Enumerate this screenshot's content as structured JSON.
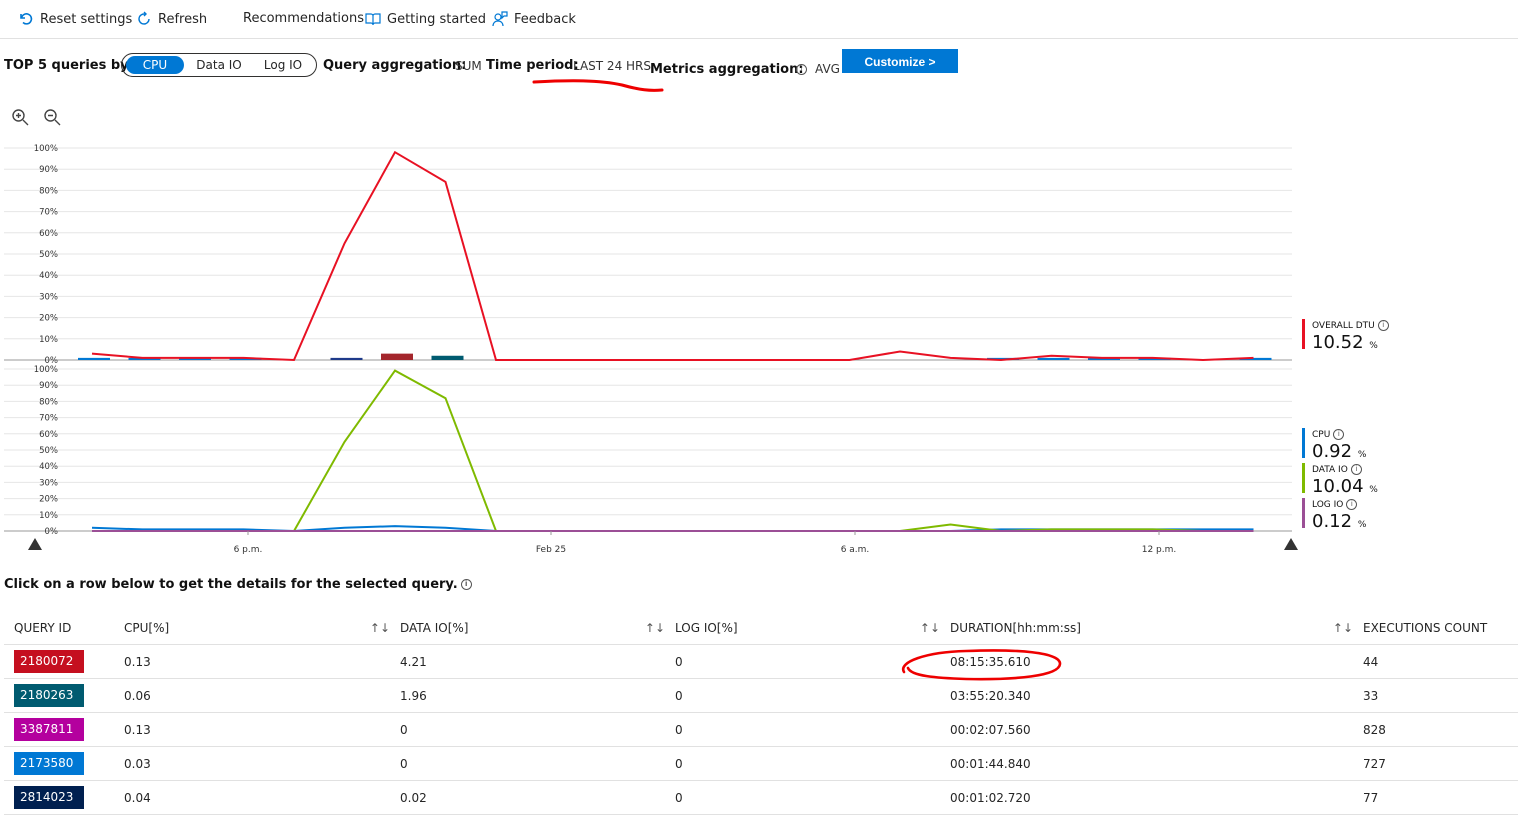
{
  "toolbar": {
    "reset": "Reset settings",
    "refresh": "Refresh",
    "recommendations": "Recommendations",
    "getting_started": "Getting started",
    "feedback": "Feedback"
  },
  "filters": {
    "top_label": "TOP 5 queries by:",
    "options": [
      "CPU",
      "Data IO",
      "Log IO"
    ],
    "selected": "CPU",
    "query_agg_label": "Query aggregation:",
    "query_agg_value": "SUM",
    "time_period_label": "Time period:",
    "time_period_value": "LAST 24 HRS",
    "metrics_agg_label": "Metrics aggregation:",
    "metrics_agg_value": "AVG",
    "customize": "Customize >"
  },
  "chart_data": [
    {
      "type": "line",
      "ylim": [
        0,
        100
      ],
      "yticks": [
        "100%",
        "90%",
        "80%",
        "70%",
        "60%",
        "50%",
        "40%",
        "30%",
        "20%",
        "10%",
        "0%"
      ],
      "series": [
        {
          "name": "OVERALL DTU",
          "color": "#e81123",
          "values": [
            3,
            1,
            1,
            1,
            0,
            55,
            98,
            84,
            0,
            0,
            0,
            0,
            0,
            0,
            0,
            0,
            4,
            1,
            0,
            2,
            1,
            1,
            0,
            1
          ]
        }
      ],
      "bars": {
        "colors": [
          "#0078d4",
          "#0078d4",
          "#0078d4",
          "#0078d4",
          "#0078d4",
          "#1e3a8a",
          "#a4262c",
          "#005b70",
          "#0078d4",
          "#0078d4",
          "#0078d4",
          "#0078d4",
          "#0078d4",
          "#0078d4",
          "#0078d4",
          "#0078d4",
          "#0078d4",
          "#0078d4",
          "#0078d4",
          "#0078d4",
          "#0078d4",
          "#0078d4",
          "#0078d4",
          "#0078d4"
        ],
        "values": [
          1,
          1,
          1,
          1,
          0,
          1,
          3,
          2,
          0,
          0,
          0,
          0,
          0,
          0,
          0,
          0,
          0,
          0,
          1,
          1,
          1,
          1,
          0,
          1
        ]
      },
      "legend": [
        {
          "label": "OVERALL DTU",
          "value": "10.52",
          "unit": "%",
          "color": "#e81123"
        }
      ]
    },
    {
      "type": "line",
      "ylim": [
        0,
        100
      ],
      "yticks": [
        "100%",
        "90%",
        "80%",
        "70%",
        "60%",
        "50%",
        "40%",
        "30%",
        "20%",
        "10%",
        "0%"
      ],
      "xticks": [
        "6 p.m.",
        "Feb 25",
        "6 a.m.",
        "12 p.m."
      ],
      "series": [
        {
          "name": "CPU",
          "color": "#0078d4",
          "values": [
            2,
            1,
            1,
            1,
            0,
            2,
            3,
            2,
            0,
            0,
            0,
            0,
            0,
            0,
            0,
            0,
            0,
            0,
            1,
            1,
            1,
            1,
            1,
            1
          ]
        },
        {
          "name": "DATA IO",
          "color": "#7fba00",
          "values": [
            0,
            0,
            0,
            0,
            0,
            55,
            99,
            82,
            0,
            0,
            0,
            0,
            0,
            0,
            0,
            0,
            0,
            4,
            0,
            1,
            1,
            1,
            0,
            0
          ]
        },
        {
          "name": "LOG IO",
          "color": "#9b4f96",
          "values": [
            0,
            0,
            0,
            0,
            0,
            0,
            0,
            0,
            0,
            0,
            0,
            0,
            0,
            0,
            0,
            0,
            0,
            0,
            0,
            0,
            0,
            0,
            0,
            0
          ]
        }
      ],
      "legend": [
        {
          "label": "CPU",
          "value": "0.92",
          "unit": "%",
          "color": "#0078d4"
        },
        {
          "label": "DATA IO",
          "value": "10.04",
          "unit": "%",
          "color": "#7fba00"
        },
        {
          "label": "LOG IO",
          "value": "0.12",
          "unit": "%",
          "color": "#9b4f96"
        }
      ]
    }
  ],
  "hint": "Click on a row below to get the details for the selected query.",
  "table": {
    "headers": [
      "QUERY ID",
      "CPU[%]",
      "DATA IO[%]",
      "LOG IO[%]",
      "DURATION[hh:mm:ss]",
      "EXECUTIONS COUNT"
    ],
    "rows": [
      {
        "id": "2180072",
        "color": "#c50f1f",
        "cpu": "0.13",
        "data_io": "4.21",
        "log_io": "0",
        "duration": "08:15:35.610",
        "exec": "44"
      },
      {
        "id": "2180263",
        "color": "#005b70",
        "cpu": "0.06",
        "data_io": "1.96",
        "log_io": "0",
        "duration": "03:55:20.340",
        "exec": "33"
      },
      {
        "id": "3387811",
        "color": "#b4009e",
        "cpu": "0.13",
        "data_io": "0",
        "log_io": "0",
        "duration": "00:02:07.560",
        "exec": "828"
      },
      {
        "id": "2173580",
        "color": "#0078d4",
        "cpu": "0.03",
        "data_io": "0",
        "log_io": "0",
        "duration": "00:01:44.840",
        "exec": "727"
      },
      {
        "id": "2814023",
        "color": "#002050",
        "cpu": "0.04",
        "data_io": "0.02",
        "log_io": "0",
        "duration": "00:01:02.720",
        "exec": "77"
      }
    ]
  }
}
